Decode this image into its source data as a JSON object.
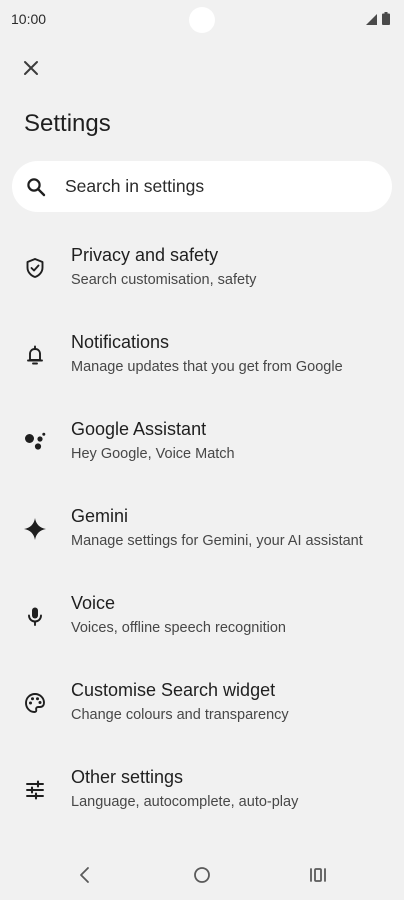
{
  "status_bar": {
    "time": "10:00",
    "icons": [
      "signal-icon",
      "battery-icon"
    ]
  },
  "header": {
    "close_icon": "close-icon",
    "title": "Settings"
  },
  "search": {
    "icon": "search-icon",
    "placeholder": "Search in settings"
  },
  "settings": {
    "items": [
      {
        "icon": "shield-icon",
        "title": "Privacy and safety",
        "subtitle": "Search customisation, safety"
      },
      {
        "icon": "bell-icon",
        "title": "Notifications",
        "subtitle": "Manage updates that you get from Google"
      },
      {
        "icon": "assistant-icon",
        "title": "Google Assistant",
        "subtitle": "Hey Google, Voice Match"
      },
      {
        "icon": "sparkle-icon",
        "title": "Gemini",
        "subtitle": "Manage settings for Gemini, your AI assistant"
      },
      {
        "icon": "microphone-icon",
        "title": "Voice",
        "subtitle": "Voices, offline speech recognition"
      },
      {
        "icon": "palette-icon",
        "title": "Customise Search widget",
        "subtitle": "Change colours and transparency"
      },
      {
        "icon": "tune-icon",
        "title": "Other settings",
        "subtitle": "Language, autocomplete, auto-play"
      }
    ]
  },
  "nav_bar": {
    "buttons": [
      "back-icon",
      "home-icon",
      "recents-icon"
    ]
  }
}
